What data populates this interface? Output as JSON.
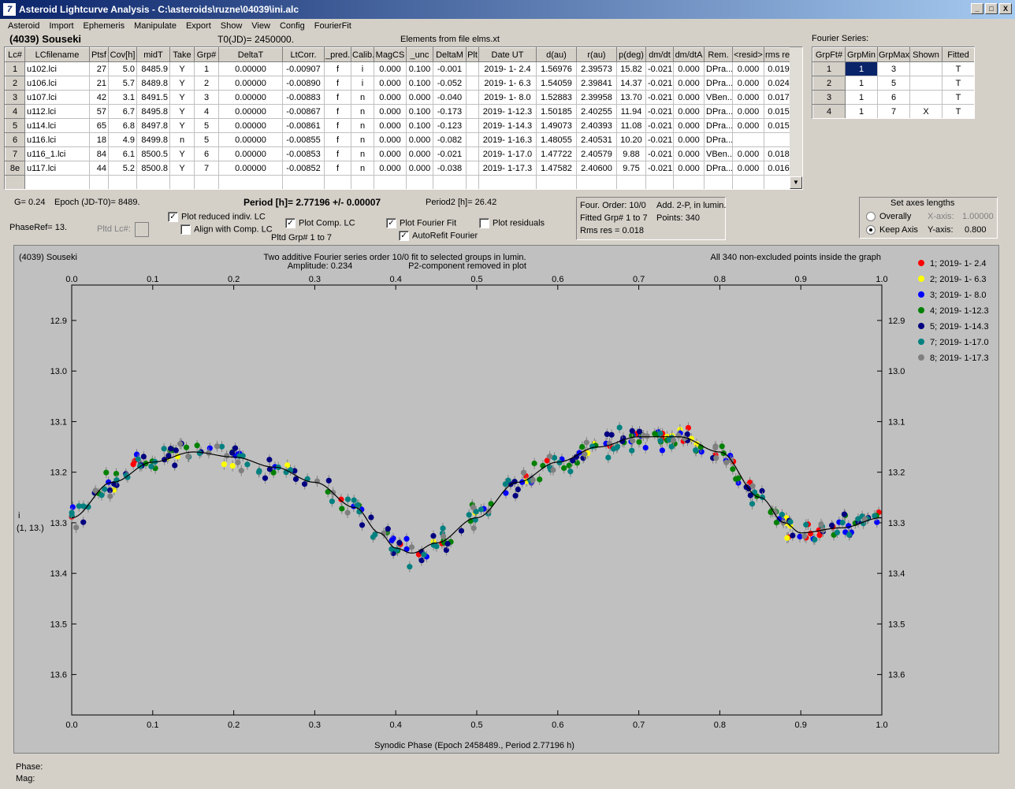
{
  "window": {
    "title": "Asteroid Lightcurve Analysis - C:\\asteroids\\ruzne\\04039\\ini.alc",
    "icon_text": "7",
    "minimize": "_",
    "maximize": "□",
    "close": "X"
  },
  "menu": [
    "Asteroid",
    "Import",
    "Ephemeris",
    "Manipulate",
    "Export",
    "Show",
    "View",
    "Config",
    "FourierFit"
  ],
  "header": {
    "asteroid": "(4039) Souseki",
    "t0": "T0(JD)= 2450000.",
    "elements": "Elements from file elms.xt",
    "fourier_series_label": "Fourier Series:"
  },
  "lc_table": {
    "columns": [
      "Lc#",
      "LCfilename",
      "Ptsf",
      "Cov[h]",
      "midT",
      "Take",
      "Grp#",
      "DeltaT",
      "LtCorr.",
      "_pred.",
      "Calib.",
      "MagCS",
      "_unc",
      "DeltaM",
      "Plt",
      "Date UT",
      "d(au)",
      "r(au)",
      "p(deg)",
      "dm/dt",
      "dm/dtA",
      "Rem.",
      "<resid>",
      "rms res"
    ],
    "rows": [
      [
        "1",
        "u102.lci",
        "27",
        "5.0",
        "8485.9",
        "Y",
        "1",
        "0.00000",
        "-0.00907",
        "f",
        "i",
        "0.000",
        "0.100",
        "-0.001",
        "",
        "2019- 1- 2.4",
        "1.56976",
        "2.39573",
        "15.82",
        "-0.021",
        "0.000",
        "DPra...",
        "0.000",
        "0.019"
      ],
      [
        "2",
        "u106.lci",
        "21",
        "5.7",
        "8489.8",
        "Y",
        "2",
        "0.00000",
        "-0.00890",
        "f",
        "i",
        "0.000",
        "0.100",
        "-0.052",
        "",
        "2019- 1- 6.3",
        "1.54059",
        "2.39841",
        "14.37",
        "-0.021",
        "0.000",
        "DPra...",
        "0.000",
        "0.024"
      ],
      [
        "3",
        "u107.lci",
        "42",
        "3.1",
        "8491.5",
        "Y",
        "3",
        "0.00000",
        "-0.00883",
        "f",
        "n",
        "0.000",
        "0.000",
        "-0.040",
        "",
        "2019- 1- 8.0",
        "1.52883",
        "2.39958",
        "13.70",
        "-0.021",
        "0.000",
        "VBen...",
        "0.000",
        "0.017"
      ],
      [
        "4",
        "u112.lci",
        "57",
        "6.7",
        "8495.8",
        "Y",
        "4",
        "0.00000",
        "-0.00867",
        "f",
        "n",
        "0.000",
        "0.100",
        "-0.173",
        "",
        "2019- 1-12.3",
        "1.50185",
        "2.40255",
        "11.94",
        "-0.021",
        "0.000",
        "DPra...",
        "0.000",
        "0.015"
      ],
      [
        "5",
        "u114.lci",
        "65",
        "6.8",
        "8497.8",
        "Y",
        "5",
        "0.00000",
        "-0.00861",
        "f",
        "n",
        "0.000",
        "0.100",
        "-0.123",
        "",
        "2019- 1-14.3",
        "1.49073",
        "2.40393",
        "11.08",
        "-0.021",
        "0.000",
        "DPra...",
        "0.000",
        "0.015"
      ],
      [
        "6",
        "u116.lci",
        "18",
        "4.9",
        "8499.8",
        "n",
        "5",
        "0.00000",
        "-0.00855",
        "f",
        "n",
        "0.000",
        "0.000",
        "-0.082",
        "",
        "2019- 1-16.3",
        "1.48055",
        "2.40531",
        "10.20",
        "-0.021",
        "0.000",
        "DPra...",
        "",
        ""
      ],
      [
        "7",
        "u116_1.lci",
        "84",
        "6.1",
        "8500.5",
        "Y",
        "6",
        "0.00000",
        "-0.00853",
        "f",
        "n",
        "0.000",
        "0.000",
        "-0.021",
        "",
        "2019- 1-17.0",
        "1.47722",
        "2.40579",
        "9.88",
        "-0.021",
        "0.000",
        "VBen...",
        "0.000",
        "0.018"
      ],
      [
        "8e",
        "u117.lci",
        "44",
        "5.2",
        "8500.8",
        "Y",
        "7",
        "0.00000",
        "-0.00852",
        "f",
        "n",
        "0.000",
        "0.000",
        "-0.038",
        "",
        "2019- 1-17.3",
        "1.47582",
        "2.40600",
        "9.75",
        "-0.021",
        "0.000",
        "DPra...",
        "0.000",
        "0.016"
      ]
    ]
  },
  "fourier_table": {
    "columns": [
      "GrpFt#",
      "GrpMin",
      "GrpMax",
      "Shown",
      "Fitted"
    ],
    "rows": [
      [
        "1",
        "1",
        "3",
        "",
        "T"
      ],
      [
        "2",
        "1",
        "5",
        "",
        "T"
      ],
      [
        "3",
        "1",
        "6",
        "",
        "T"
      ],
      [
        "4",
        "1",
        "7",
        "X",
        "T"
      ]
    ]
  },
  "controls": {
    "g": "G= 0.24",
    "epoch": "Epoch (JD-T0)= 8489.",
    "period": "Period [h]= 2.77196 +/- 0.00007",
    "period2": "Period2 [h]= 26.42",
    "phaseref": "PhaseRef= 13.",
    "pltd_lc": "Pltd Lc#:",
    "plot_reduced": "Plot reduced indiv. LC",
    "align_comp": "Align with Comp. LC",
    "plot_comp": "Plot Comp. LC",
    "pltd_grp": "Pltd Grp#  1   to   7",
    "plot_fourier": "Plot Fourier Fit",
    "autorefit": "AutoRefit Fourier",
    "plot_residuals": "Plot residuals",
    "four_order": "Four. Order: 10/0",
    "add_2p": "Add. 2-P, in lumin.",
    "fitted_grp": "Fitted Grp# 1 to 7",
    "points": "Points: 340",
    "rms_res": "Rms res     = 0.018",
    "axes_title": "Set axes lengths",
    "overally": "Overally",
    "keep_axis": "Keep Axis",
    "x_axis_label": "X-axis:",
    "x_axis_value": "1.00000",
    "y_axis_label": "Y-axis:",
    "y_axis_value": "0.800"
  },
  "chart_data": {
    "type": "scatter",
    "title_left": "(4039) Souseki",
    "title": "Two additive Fourier series order 10/0 fit to selected groups in lumin.",
    "subtitle_amp": "Amplitude: 0.234",
    "subtitle_p2": "P2-component removed in plot",
    "title_right": "All 340 non-excluded points inside the graph",
    "xlabel": "Synodic Phase (Epoch 2458489., Period 2.77196 h)",
    "ylabel_1": "i",
    "ylabel_2": "(1, 13.)",
    "xlim": [
      0,
      1
    ],
    "ylim": [
      13.68,
      12.83
    ],
    "xticks": [
      "0.0",
      "0.1",
      "0.2",
      "0.3",
      "0.4",
      "0.5",
      "0.6",
      "0.7",
      "0.8",
      "0.9",
      "1.0"
    ],
    "yticks": [
      "12.9",
      "13.0",
      "13.1",
      "13.2",
      "13.3",
      "13.4",
      "13.5",
      "13.6"
    ],
    "series": [
      {
        "name": "1; 2019- 1- 2.4",
        "color": "#ff0000",
        "phase_range": [
          0.0,
          1.0
        ]
      },
      {
        "name": "2; 2019- 1- 6.3",
        "color": "#ffff00",
        "phase_range": [
          0.0,
          1.0
        ]
      },
      {
        "name": "3; 2019- 1- 8.0",
        "color": "#0000ff",
        "phase_range": [
          0.0,
          1.0
        ]
      },
      {
        "name": "4; 2019- 1-12.3",
        "color": "#008000",
        "phase_range": [
          0.0,
          1.0
        ]
      },
      {
        "name": "5; 2019- 1-14.3",
        "color": "#000080",
        "phase_range": [
          0.0,
          1.0
        ]
      },
      {
        "name": "7; 2019- 1-17.0",
        "color": "#008080",
        "phase_range": [
          0.0,
          1.0
        ]
      },
      {
        "name": "8; 2019- 1-17.3",
        "color": "#808080",
        "phase_range": [
          0.0,
          1.0
        ]
      }
    ],
    "fit_curve": {
      "x": [
        0.0,
        0.05,
        0.1,
        0.15,
        0.2,
        0.25,
        0.3,
        0.35,
        0.38,
        0.4,
        0.42,
        0.45,
        0.5,
        0.55,
        0.6,
        0.65,
        0.7,
        0.75,
        0.8,
        0.85,
        0.88,
        0.9,
        0.95,
        1.0
      ],
      "y": [
        13.29,
        13.22,
        13.18,
        13.16,
        13.17,
        13.19,
        13.22,
        13.27,
        13.32,
        13.35,
        13.36,
        13.34,
        13.29,
        13.22,
        13.18,
        13.15,
        13.13,
        13.13,
        13.16,
        13.25,
        13.3,
        13.32,
        13.31,
        13.29
      ]
    }
  },
  "status": {
    "phase": "Phase:",
    "mag": "Mag:"
  }
}
